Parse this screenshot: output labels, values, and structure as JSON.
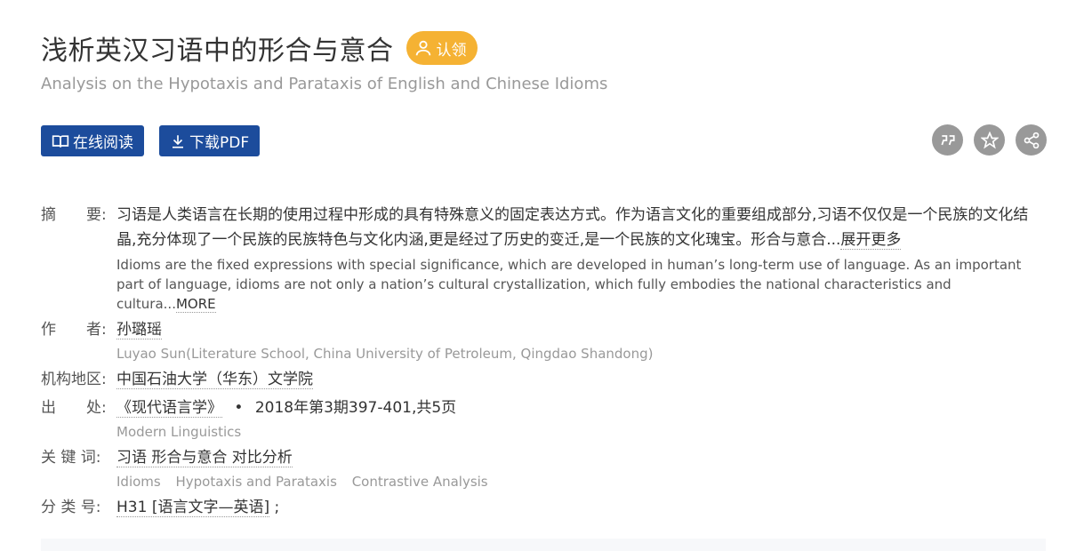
{
  "paper": {
    "title": "浅析英汉习语中的形合与意合",
    "claim_label": "认领",
    "subtitle": "Analysis on the Hypotaxis and Parataxis of English and Chinese Idioms"
  },
  "actions": {
    "read_online": "在线阅读",
    "download_pdf": "下载PDF"
  },
  "tools": [
    "quote-icon",
    "star-icon",
    "share-icon"
  ],
  "meta": {
    "abstract_label": "摘　　要:",
    "abstract_zh": "习语是人类语言在长期的使用过程中形成的具有特殊意义的固定表达方式。作为语言文化的重要组成部分,习语不仅仅是一个民族的文化结晶,充分体现了一个民族的民族特色与文化内涵,更是经过了历史的变迁,是一个民族的文化瑰宝。形合与意合...",
    "abstract_zh_more": "展开更多",
    "abstract_en": "Idioms are the fixed expressions with special significance, which are developed in human’s long-term use of language. As an important part of language, idioms are not only a nation’s cultural crystallization, which fully embodies the national characteristics and cultura...",
    "abstract_en_more": "MORE",
    "author_label": "作　　者:",
    "author": "孙璐瑶",
    "author_en": "Luyao Sun(Literature School, China University of Petroleum, Qingdao Shandong)",
    "org_label": "机构地区:",
    "org": "中国石油大学（华东）文学院",
    "source_label": "出　　处:",
    "source_journal": "《现代语言学》",
    "source_dot": "•",
    "source_issue": "2018年第3期397-401,共5页",
    "source_en": "Modern Linguistics",
    "keywords_label": "关 键 词:",
    "keywords_zh": "习语 形合与意合 对比分析",
    "keywords_en": [
      "Idioms",
      "Hypotaxis and Parataxis",
      "Contrastive Analysis"
    ],
    "class_label": "分 类 号:",
    "class_code": "H31 [语言文字—英语]",
    "class_suffix": " ;"
  },
  "colors": {
    "accent": "#1c4c9c",
    "claim": "#f5b233",
    "tool": "#999999"
  }
}
